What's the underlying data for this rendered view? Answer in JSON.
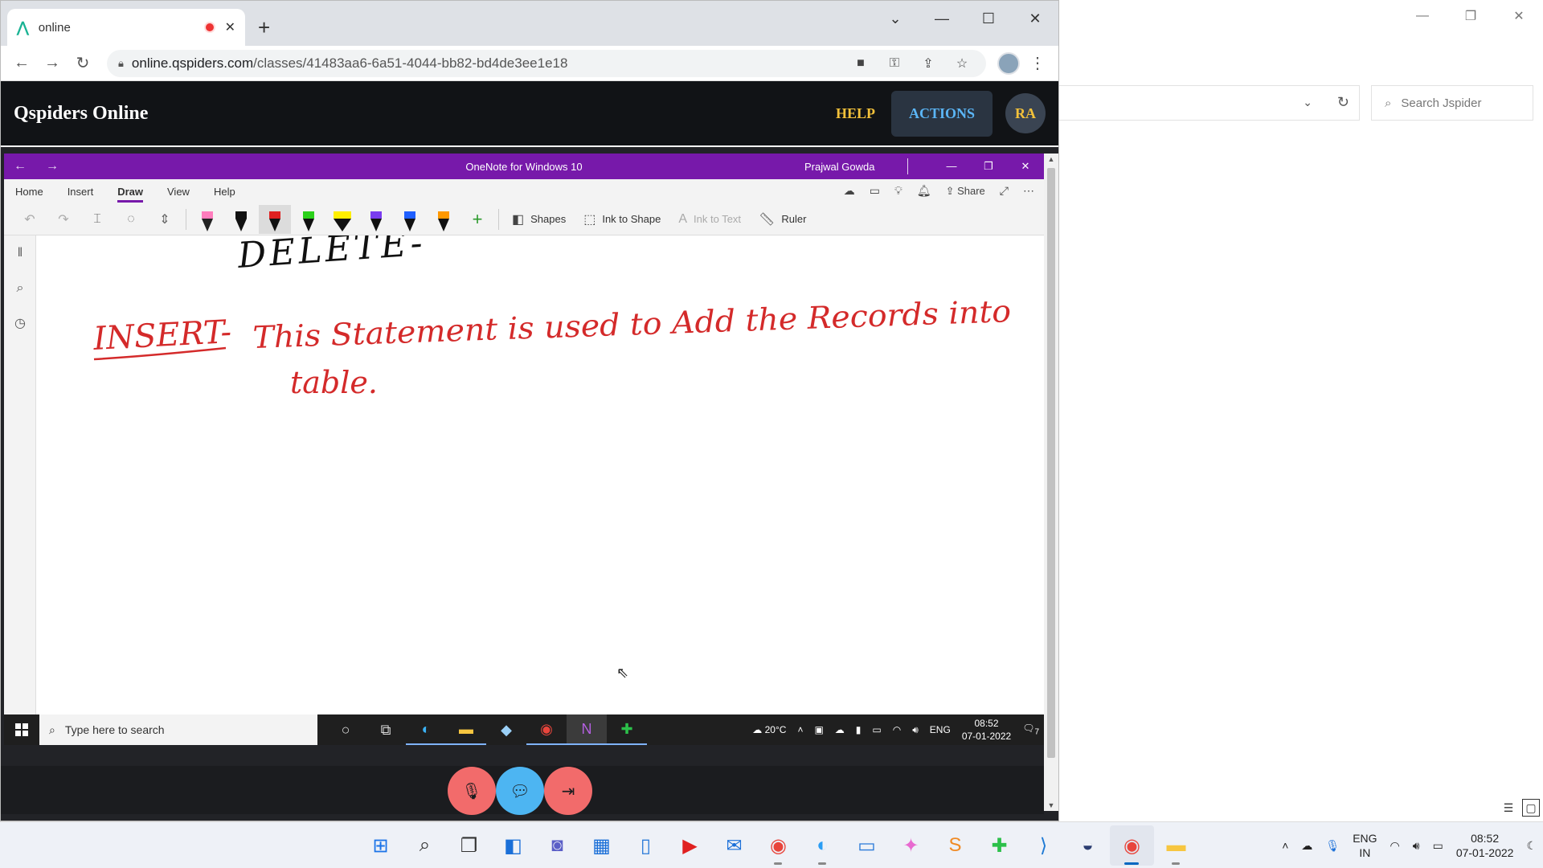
{
  "bg_window": {
    "search_placeholder": "Search Jspider"
  },
  "browser": {
    "tab_title": "online",
    "url_host": "online.qspiders.com",
    "url_path": "/classes/41483aa6-6a51-4044-bb82-bd4de3ee1e18"
  },
  "app": {
    "brand": "Qspiders Online",
    "help_label": "HELP",
    "actions_label": "ACTIONS",
    "avatar_initials": "RA"
  },
  "onenote": {
    "window_title": "OneNote for Windows 10",
    "user_name": "Prajwal Gowda",
    "menu": [
      "Home",
      "Insert",
      "Draw",
      "View",
      "Help"
    ],
    "active_menu": "Draw",
    "share_label": "Share",
    "tools": {
      "shapes": "Shapes",
      "ink_to_shape": "Ink to Shape",
      "ink_to_text": "Ink to Text",
      "ruler": "Ruler"
    },
    "ink": {
      "line1": "DELETE-",
      "line2_keyword": "INSERT-",
      "line2_rest": "This Statement is used to Add the Records into",
      "line3": "table."
    },
    "ink_colors": {
      "black": "#111111",
      "red": "#d42a2a"
    }
  },
  "inner_taskbar": {
    "search_placeholder": "Type here to search",
    "weather": "20°C",
    "lang": "ENG",
    "time": "08:52",
    "date": "07-01-2022",
    "notification_count": "7"
  },
  "taskbar": {
    "lang_line1": "ENG",
    "lang_line2": "IN",
    "time": "08:52",
    "date": "07-01-2022"
  },
  "colors": {
    "onenote_purple": "#7719aa",
    "qspiders_header": "#111316",
    "help_gold": "#f3c13a",
    "actions_blue": "#5bb5f5",
    "call_red": "#f26b6b",
    "call_blue": "#4db5f2"
  }
}
